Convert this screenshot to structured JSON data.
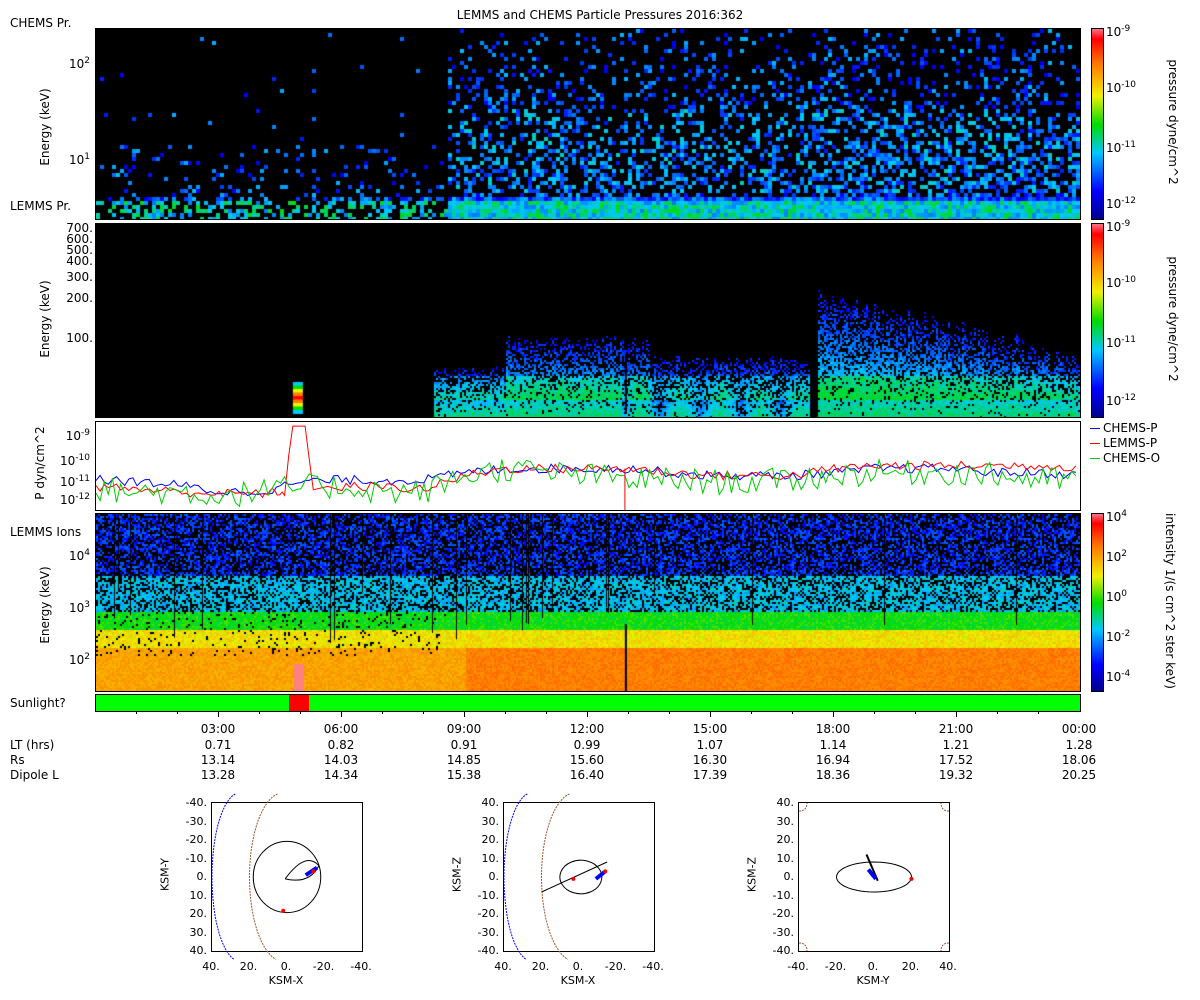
{
  "title": "LEMMS and CHEMS Particle Pressures  2016:362",
  "panels": {
    "chems_pr": {
      "label": "CHEMS Pr.",
      "ylabel": "Energy (keV)",
      "yticks": [
        {
          "v": 100,
          "t": "10",
          "sup": "2"
        },
        {
          "v": 10,
          "t": "10",
          "sup": "1"
        }
      ],
      "cbar_label": "pressure dyne/cm^2",
      "cbar_ticks": [
        {
          "t": "10",
          "sup": "-9"
        },
        {
          "t": "10",
          "sup": "-10"
        },
        {
          "t": "10",
          "sup": "-11"
        },
        {
          "t": "10",
          "sup": "-12"
        }
      ]
    },
    "lemms_pr": {
      "label": "LEMMS Pr.",
      "ylabel": "Energy (keV)",
      "yticks": [
        "700.",
        "600.",
        "500.",
        "400.",
        "300.",
        "200.",
        "100."
      ],
      "cbar_label": "pressure dyne/cm^2",
      "cbar_ticks": [
        {
          "t": "10",
          "sup": "-9"
        },
        {
          "t": "10",
          "sup": "-10"
        },
        {
          "t": "10",
          "sup": "-11"
        },
        {
          "t": "10",
          "sup": "-12"
        }
      ]
    },
    "pressure": {
      "ylabel": "P dyn/cm^2",
      "yticks": [
        {
          "t": "10",
          "sup": "-9"
        },
        {
          "t": "10",
          "sup": "-10"
        },
        {
          "t": "10",
          "sup": "-11"
        },
        {
          "t": "10",
          "sup": "-12"
        }
      ],
      "legend": [
        {
          "name": "CHEMS-P",
          "color": "#0000ff"
        },
        {
          "name": "LEMMS-P",
          "color": "#ff0000"
        },
        {
          "name": "CHEMS-O",
          "color": "#00cc00"
        }
      ]
    },
    "lemms_ions": {
      "label": "LEMMS Ions",
      "ylabel": "Energy (keV)",
      "yticks": [
        {
          "t": "10",
          "sup": "4"
        },
        {
          "t": "10",
          "sup": "3"
        },
        {
          "t": "10",
          "sup": "2"
        }
      ],
      "cbar_label": "intensity 1/(s cm^2 ster keV)",
      "cbar_ticks": [
        {
          "t": "10",
          "sup": "4"
        },
        {
          "t": "10",
          "sup": "2"
        },
        {
          "t": "10",
          "sup": "0"
        },
        {
          "t": "10",
          "sup": "-2"
        },
        {
          "t": "10",
          "sup": "-4"
        }
      ]
    },
    "sunlight": {
      "label": "Sunlight?",
      "shadow_start_hour": 4.7,
      "shadow_end_hour": 5.2
    }
  },
  "time_axis": {
    "ticks": [
      "03:00",
      "06:00",
      "09:00",
      "12:00",
      "15:00",
      "18:00",
      "21:00",
      "00:00"
    ],
    "rows": [
      {
        "label": "LT (hrs)",
        "values": [
          "0.71",
          "0.82",
          "0.91",
          "0.99",
          "1.07",
          "1.14",
          "1.21",
          "1.28"
        ]
      },
      {
        "label": "Rs",
        "values": [
          "13.14",
          "14.03",
          "14.85",
          "15.60",
          "16.30",
          "16.94",
          "17.52",
          "18.06"
        ]
      },
      {
        "label": "Dipole L",
        "values": [
          "13.28",
          "14.34",
          "15.38",
          "16.40",
          "17.39",
          "18.36",
          "19.32",
          "20.25"
        ]
      }
    ]
  },
  "orbits": [
    {
      "xlabel": "KSM-X",
      "ylabel": "KSM-Y",
      "xticks": [
        "40.",
        "20.",
        "0.",
        "-20.",
        "-40."
      ],
      "yticks": [
        "-40.",
        "-30.",
        "-20.",
        "-10.",
        "0.",
        "10.",
        "20.",
        "30.",
        "40."
      ]
    },
    {
      "xlabel": "KSM-X",
      "ylabel": "KSM-Z",
      "xticks": [
        "40.",
        "20.",
        "0.",
        "-20.",
        "-40."
      ],
      "yticks": [
        "40.",
        "30.",
        "20.",
        "10.",
        "0.",
        "-10.",
        "-20.",
        "-30.",
        "-40."
      ]
    },
    {
      "xlabel": "KSM-Y",
      "ylabel": "KSM-Z",
      "xticks": [
        "-40.",
        "-20.",
        "0.",
        "20.",
        "40."
      ],
      "yticks": [
        "40.",
        "30.",
        "20.",
        "10.",
        "0.",
        "-10.",
        "-20.",
        "-30.",
        "-40."
      ]
    }
  ],
  "chart_data": [
    {
      "type": "heatmap",
      "name": "CHEMS Pr.",
      "x_range_hours": [
        0,
        24
      ],
      "y_scale": "log",
      "ylim_keV": [
        3,
        250
      ],
      "z_scale": "log",
      "zlim": [
        1e-12,
        1e-09
      ],
      "description_values": {
        "onset_hour": 8.5,
        "peak_activity_hours": [
          17.5,
          24
        ]
      }
    },
    {
      "type": "heatmap",
      "name": "LEMMS Pr.",
      "x_range_hours": [
        0,
        24
      ],
      "y_scale": "log",
      "ylim_keV": [
        27,
        750
      ],
      "z_scale": "log",
      "zlim": [
        1e-12,
        1e-09
      ],
      "burst_hour": 4.9
    },
    {
      "type": "line",
      "x_range_hours": [
        0,
        24
      ],
      "y_scale": "log",
      "ylim": [
        5e-13,
        3e-09
      ],
      "series": [
        {
          "name": "CHEMS-P",
          "x": [
            0,
            1,
            2,
            3,
            4,
            5,
            6,
            7,
            8,
            9,
            10,
            11,
            12,
            13,
            14,
            15,
            16,
            17,
            18,
            19,
            20,
            21,
            22,
            23,
            24
          ],
          "y": [
            1e-11,
            8e-12,
            6e-12,
            3e-12,
            3e-12,
            8e-12,
            1e-11,
            9e-12,
            1e-11,
            2e-11,
            3e-11,
            3e-11,
            3e-11,
            3e-11,
            2e-11,
            1.5e-11,
            1.5e-11,
            1.5e-11,
            2e-11,
            3e-11,
            3e-11,
            3e-11,
            2e-11,
            2e-11,
            1.5e-11
          ]
        },
        {
          "name": "LEMMS-P",
          "x": [
            0,
            1,
            2,
            3,
            4,
            4.6,
            4.8,
            5.1,
            5.3,
            6,
            7,
            8,
            9,
            10,
            11,
            12,
            13,
            14,
            15,
            16,
            17,
            18,
            19,
            20,
            21,
            22,
            23,
            24
          ],
          "y": [
            5e-12,
            4e-12,
            3e-12,
            2.5e-12,
            2.5e-12,
            3e-12,
            2e-09,
            2e-09,
            3e-12,
            5e-12,
            5e-12,
            4e-12,
            1.5e-11,
            3e-11,
            3e-11,
            3e-11,
            3e-11,
            2e-11,
            1.5e-11,
            1.5e-11,
            1.5e-11,
            3e-11,
            4e-11,
            4e-11,
            4e-11,
            4e-11,
            4e-11,
            3.5e-11
          ]
        },
        {
          "name": "CHEMS-O",
          "x": [
            0,
            1,
            2,
            3,
            4,
            5,
            6,
            7,
            8,
            9,
            10,
            11,
            12,
            13,
            14,
            15,
            16,
            17,
            18,
            19,
            20,
            21,
            22,
            23,
            24
          ],
          "y": [
            4e-12,
            3e-12,
            3e-12,
            2e-12,
            3e-12,
            5e-12,
            5e-12,
            3e-12,
            3e-12,
            1.5e-11,
            3e-11,
            2e-11,
            1.5e-11,
            1e-11,
            1e-11,
            8e-12,
            8e-12,
            1e-11,
            1.5e-11,
            2e-11,
            2e-11,
            2e-11,
            1.5e-11,
            1e-11,
            1e-11
          ]
        }
      ]
    },
    {
      "type": "heatmap",
      "name": "LEMMS Ions",
      "x_range_hours": [
        0,
        24
      ],
      "y_scale": "log",
      "ylim_keV": [
        27,
        60000
      ],
      "z_scale": "log",
      "zlim": [
        3e-05,
        10000.0
      ]
    }
  ]
}
